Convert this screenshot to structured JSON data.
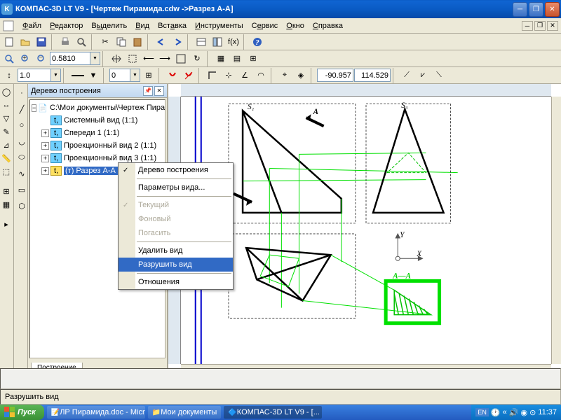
{
  "window": {
    "title": "КОМПАС-3D LT V9 - [Чертеж Пирамида.cdw ->Разрез А-А]"
  },
  "menu": {
    "items": [
      "Файл",
      "Редактор",
      "Выделить",
      "Вид",
      "Вставка",
      "Инструменты",
      "Сервис",
      "Окно",
      "Справка"
    ]
  },
  "toolbar2": {
    "zoom_val": "0.5810"
  },
  "toolbar3": {
    "val1": "1.0",
    "val2": "0",
    "coord_x": "-90.957",
    "coord_y": "114.529"
  },
  "tree": {
    "title": "Дерево построения",
    "doc": "С:\\Мои документы\\Чертеж Пира",
    "items": [
      "Системный вид (1:1)",
      "Спереди 1 (1:1)",
      "Проекционный вид 2 (1:1)",
      "Проекционный вид 3 (1:1)",
      "(т) Разрез А-А (1:1)"
    ],
    "tab": "Построение"
  },
  "context": {
    "items": [
      "Дерево построения",
      "Параметры вида...",
      "Текущий",
      "Фоновый",
      "Погасить",
      "Удалить вид",
      "Разрушить вид",
      "Отношения"
    ]
  },
  "drawing": {
    "label_A": "А",
    "label_AA": "А—А",
    "label_Y": "Y",
    "label_X": "X"
  },
  "statusbar": {
    "text": "Разрушить вид"
  },
  "taskbar": {
    "start": "Пуск",
    "items": [
      "ЛР Пирамида.doc - Micr...",
      "Мои документы",
      "КОМПАС-3D LT V9 - [..."
    ],
    "lang": "EN",
    "time": "11:37"
  }
}
